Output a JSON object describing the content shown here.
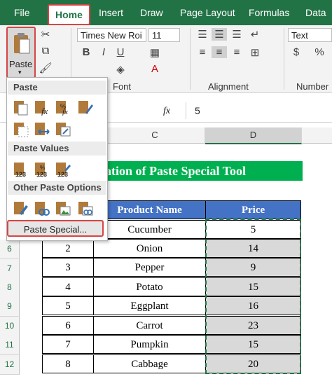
{
  "tabs": [
    "File",
    "Home",
    "Insert",
    "Draw",
    "Page Layout",
    "Formulas",
    "Data"
  ],
  "ribbon": {
    "paste_label": "Paste",
    "font_name": "Times New Roi",
    "font_size": "11",
    "number_format": "Text",
    "bold": "B",
    "italic": "I",
    "underline": "U",
    "groups": [
      "Font",
      "Alignment",
      "Number"
    ]
  },
  "formula_bar": {
    "fx": "fx",
    "value": "5"
  },
  "columns": [
    "C",
    "D"
  ],
  "rows": [
    "6",
    "7",
    "8",
    "9",
    "10",
    "11",
    "12"
  ],
  "sheet": {
    "title": "ation of Paste Special Tool",
    "headers": [
      "Product Name",
      "Price"
    ],
    "table": [
      {
        "sl": "",
        "product": "Cucumber",
        "price": "5"
      },
      {
        "sl": "2",
        "product": "Onion",
        "price": "14"
      },
      {
        "sl": "3",
        "product": "Pepper",
        "price": "9"
      },
      {
        "sl": "4",
        "product": "Potato",
        "price": "15"
      },
      {
        "sl": "5",
        "product": "Eggplant",
        "price": "16"
      },
      {
        "sl": "6",
        "product": "Carrot",
        "price": "23"
      },
      {
        "sl": "7",
        "product": "Pumpkin",
        "price": "15"
      },
      {
        "sl": "8",
        "product": "Cabbage",
        "price": "20"
      }
    ]
  },
  "menu": {
    "sections": [
      "Paste",
      "Paste Values",
      "Other Paste Options"
    ],
    "paste_special": "Paste Special..."
  },
  "colors": {
    "excel_green": "#217346",
    "highlight_red": "#d64545",
    "header_blue": "#4472c4",
    "title_green": "#00b050"
  }
}
